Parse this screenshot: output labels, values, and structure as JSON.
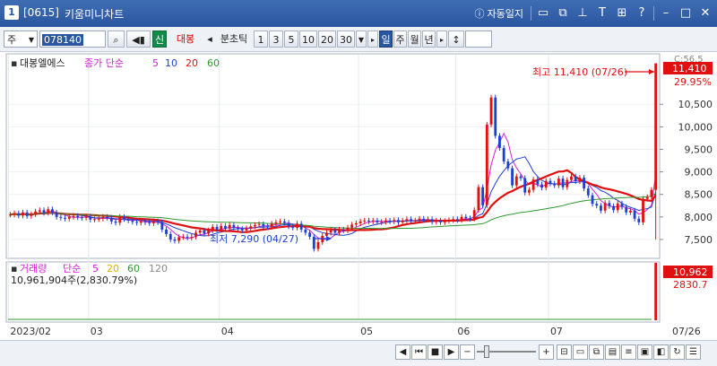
{
  "window": {
    "number": "1",
    "code": "[0615]",
    "title": "키움미니차트",
    "auto_label": "자동일지",
    "icons": [
      "info-icon",
      "window-icon",
      "link-icon",
      "pin-icon",
      "text-icon",
      "grid-icon",
      "help-icon",
      "minimize-icon",
      "restore-icon",
      "close-icon"
    ]
  },
  "toolbar": {
    "market": "주",
    "stock_code": "078140",
    "stock_name": "대봉",
    "new_label": "신",
    "unit_label": "분초틱",
    "minute_buttons": [
      "1",
      "3",
      "5",
      "10",
      "20",
      "30"
    ],
    "selected_period": "일",
    "periods": [
      "일",
      "주",
      "월",
      "년"
    ]
  },
  "price_pane": {
    "name": "대봉엘에스",
    "ma_label": "종가 단순",
    "ma_periods": [
      "5",
      "10",
      "20",
      "60"
    ],
    "ma_colors": [
      "#d61fd6",
      "#1f3fd1",
      "#e01010",
      "#2e9a2e"
    ],
    "high_annotation": "최고 11,410 (07/26)",
    "low_annotation": "최저 7,290 (04/27)",
    "price_tag_top": "C:56.5",
    "current_price": "11,410",
    "change_pct": "29.95%"
  },
  "volume_pane": {
    "name": "거래량",
    "ma_label": "단순",
    "ma_periods": [
      "5",
      "20",
      "60",
      "120"
    ],
    "ma_colors": [
      "#d61fd6",
      "#e0b000",
      "#2e9a2e",
      "#888888"
    ],
    "info_text": "10,961,904주(2,830.79%)",
    "volume_tag": "10,962",
    "pct_tag": "2830.7"
  },
  "x_axis": [
    "2023/02",
    "03",
    "04",
    "05",
    "06",
    "07",
    "07/26"
  ],
  "chart_data": {
    "type": "candlestick",
    "title": "대봉엘에스",
    "y_ticks": [
      "7,500",
      "8,000",
      "8,500",
      "9,000",
      "9,500",
      "10,000",
      "10,500"
    ],
    "ylim": [
      7100,
      11600
    ],
    "period_months": [
      "2023/02",
      "03",
      "04",
      "05",
      "06",
      "07"
    ],
    "high": {
      "value": 11410,
      "date": "07/26"
    },
    "low": {
      "value": 7290,
      "date": "04/27"
    },
    "close": [
      8050,
      8080,
      8030,
      8100,
      8020,
      8060,
      8120,
      8150,
      8090,
      8170,
      8100,
      8000,
      7980,
      7960,
      8000,
      8020,
      7990,
      7980,
      8010,
      7940,
      7950,
      7960,
      8000,
      7980,
      7900,
      7870,
      8000,
      7950,
      7920,
      7890,
      7870,
      7900,
      7880,
      7860,
      7900,
      7880,
      7720,
      7620,
      7500,
      7470,
      7550,
      7560,
      7540,
      7560,
      7650,
      7700,
      7630,
      7700,
      7780,
      7720,
      7800,
      7740,
      7820,
      7760,
      7730,
      7700,
      7750,
      7790,
      7820,
      7840,
      7790,
      7780,
      7850,
      7880,
      7900,
      7870,
      7790,
      7760,
      7850,
      7720,
      7650,
      7560,
      7290,
      7440,
      7580,
      7650,
      7700,
      7650,
      7720,
      7700,
      7760,
      7830,
      7860,
      7900,
      7920,
      7900,
      7920,
      7880,
      7890,
      7920,
      7900,
      7930,
      7880,
      7920,
      7950,
      7920,
      7920,
      7960,
      7940,
      7950,
      7890,
      7920,
      7880,
      7910,
      7930,
      7950,
      7930,
      8000,
      7970,
      7960,
      8150,
      8660,
      8260,
      10050,
      10650,
      9800,
      9530,
      9230,
      9080,
      8700,
      8900,
      8860,
      8540,
      8600,
      8830,
      8720,
      8650,
      8800,
      8740,
      8700,
      8850,
      8660,
      8820,
      8900,
      8790,
      8870,
      8630,
      8480,
      8290,
      8250,
      8140,
      8310,
      8240,
      8150,
      8300,
      8220,
      8100,
      8140,
      7960,
      7880,
      8400,
      8440,
      8600,
      11410
    ],
    "volume": [
      null,
      null,
      null,
      null,
      null,
      null,
      null,
      null,
      null,
      null,
      null,
      null,
      null,
      null,
      null,
      null,
      null,
      null,
      null,
      null,
      null,
      null,
      null,
      null,
      null,
      null,
      null,
      null,
      null,
      null,
      null,
      null,
      null,
      null,
      null,
      null,
      null,
      null,
      null,
      null,
      null,
      null,
      null,
      null,
      null,
      null,
      null,
      null,
      null,
      null,
      null,
      null,
      null,
      null,
      null,
      null,
      null,
      null,
      null,
      null,
      null,
      null,
      null,
      null,
      null,
      null,
      null,
      null,
      null,
      null,
      null,
      null,
      null,
      null,
      null,
      null,
      null,
      null,
      null,
      null,
      null,
      null,
      null,
      null,
      null,
      null,
      null,
      null,
      null,
      null,
      null,
      null,
      null,
      null,
      null,
      null,
      null,
      null,
      null,
      null,
      null,
      null,
      null,
      null,
      null,
      null,
      null,
      null,
      null,
      null,
      null,
      null,
      null,
      null,
      null,
      null,
      null,
      null,
      null,
      null,
      null,
      null,
      null,
      null,
      null,
      null,
      null,
      null,
      null,
      null,
      null,
      null,
      null,
      null,
      null,
      null,
      null,
      null,
      null,
      null,
      null,
      null,
      null,
      null,
      null,
      null,
      null,
      null,
      null,
      null,
      null,
      null,
      null,
      10962
    ]
  }
}
